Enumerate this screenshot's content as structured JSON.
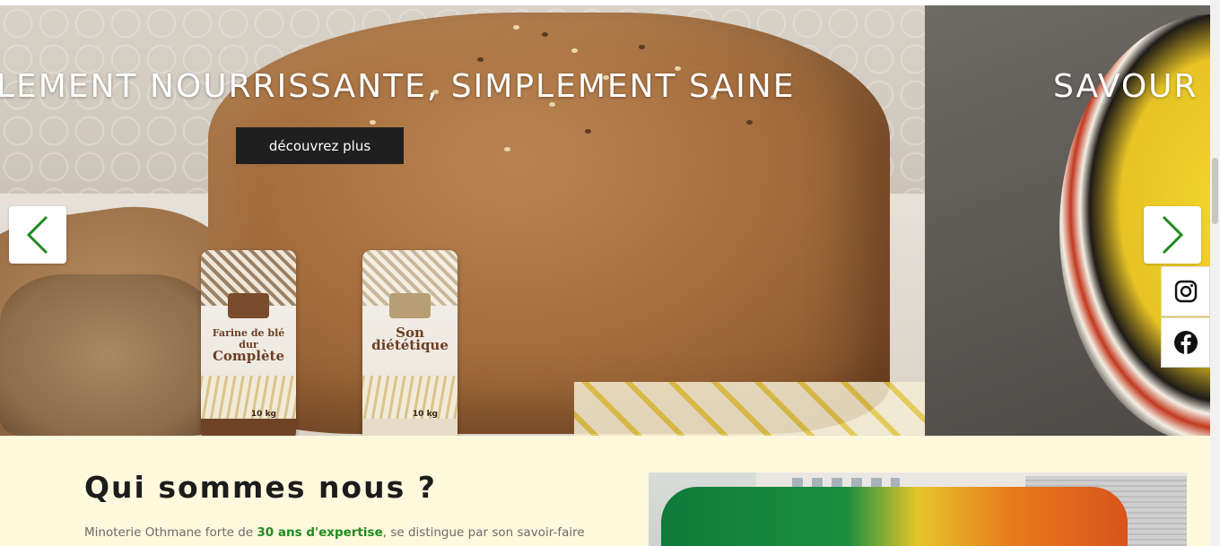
{
  "hero": {
    "slides": [
      {
        "headline": "LEMENT NOURRISSANTE, SIMPLEMENT SAINE",
        "cta_label": "découvrez plus"
      },
      {
        "headline": "SAVOUR"
      }
    ],
    "products": [
      {
        "line1": "Farine de blé dur",
        "line2": "Complète",
        "weight": "10 kg"
      },
      {
        "line1": "Son",
        "line2": "diététique",
        "weight": "10 kg"
      }
    ],
    "prev_icon": "chevron-left-icon",
    "next_icon": "chevron-right-icon",
    "arrow_color": "#1f8a1f"
  },
  "social": [
    {
      "name": "instagram-icon"
    },
    {
      "name": "facebook-icon"
    }
  ],
  "about": {
    "title": "Qui sommes nous ?",
    "text_before": "Minoterie Othmane forte de ",
    "text_highlight": "30 ans d'expertise",
    "text_after": ", se distingue par son savoir-faire"
  },
  "colors": {
    "accent_green": "#1f8a1f",
    "section_bg": "#fef8dd",
    "button_bg": "#1f1f1f"
  }
}
